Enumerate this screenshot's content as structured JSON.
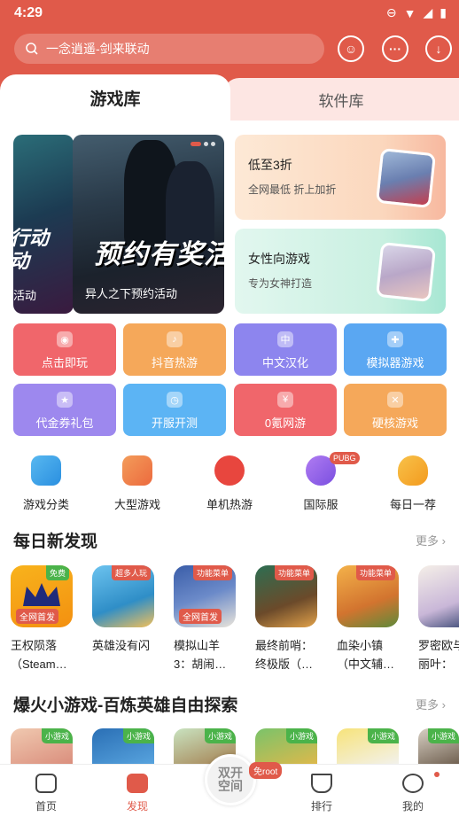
{
  "status_bar": {
    "time": "4:29"
  },
  "search": {
    "placeholder": "一念逍遥-剑来联动"
  },
  "tabs": [
    {
      "label": "游戏库",
      "active": true
    },
    {
      "label": "软件库",
      "active": false
    }
  ],
  "banners": [
    {
      "caption": "活动",
      "overlay_text": "行动\n动"
    },
    {
      "caption": "异人之下预约活动",
      "overlay_text": "预约有奖活"
    }
  ],
  "promos": [
    {
      "title": "低至3折",
      "subtitle": "全网最低 折上加折"
    },
    {
      "title": "女性向游戏",
      "subtitle": "专为女神打造"
    }
  ],
  "grid_buttons": [
    {
      "label": "点击即玩",
      "color": "#f0666b"
    },
    {
      "label": "抖音热游",
      "color": "#f5a85a"
    },
    {
      "label": "中文汉化",
      "color": "#8d85ee"
    },
    {
      "label": "模拟器游戏",
      "color": "#5aa7f2"
    },
    {
      "label": "代金券礼包",
      "color": "#9d88ee"
    },
    {
      "label": "开服开测",
      "color": "#5cb4f4"
    },
    {
      "label": "0氪网游",
      "color": "#f0666b"
    },
    {
      "label": "硬核游戏",
      "color": "#f5a85a"
    }
  ],
  "categories": [
    {
      "label": "游戏分类"
    },
    {
      "label": "大型游戏"
    },
    {
      "label": "单机热游"
    },
    {
      "label": "国际服",
      "badge": "PUBG"
    },
    {
      "label": "每日一荐"
    }
  ],
  "section_daily": {
    "title": "每日新发现",
    "more": "更多 ›",
    "games": [
      {
        "name_line1": "王权陨落",
        "name_line2": "（Steam…",
        "tag": "免费",
        "icon_text": "全网首发"
      },
      {
        "name_line1": "英雄没有闪",
        "name_line2": "",
        "tag": "超多人玩",
        "icon_text": ""
      },
      {
        "name_line1": "模拟山羊",
        "name_line2": "3：胡闹…",
        "tag": "功能菜单",
        "icon_text": "全网首发"
      },
      {
        "name_line1": "最终前哨：",
        "name_line2": "终极版（…",
        "tag": "功能菜单",
        "icon_text": ""
      },
      {
        "name_line1": "血染小镇",
        "name_line2": "（中文辅…",
        "tag": "功能菜单",
        "icon_text": ""
      },
      {
        "name_line1": "罗密欧与",
        "name_line2": "丽叶：",
        "tag": "",
        "icon_text": ""
      }
    ]
  },
  "section_mini": {
    "title": "爆火小游戏-百炼英雄自由探索",
    "more": "更多 ›",
    "tag": "小游戏"
  },
  "bottom_nav": {
    "items": [
      {
        "label": "首页"
      },
      {
        "label": "发现",
        "active": true
      },
      {
        "label": "排行"
      },
      {
        "label": "我的"
      }
    ],
    "center_label": "双开\n空间",
    "center_badge": "免root"
  }
}
